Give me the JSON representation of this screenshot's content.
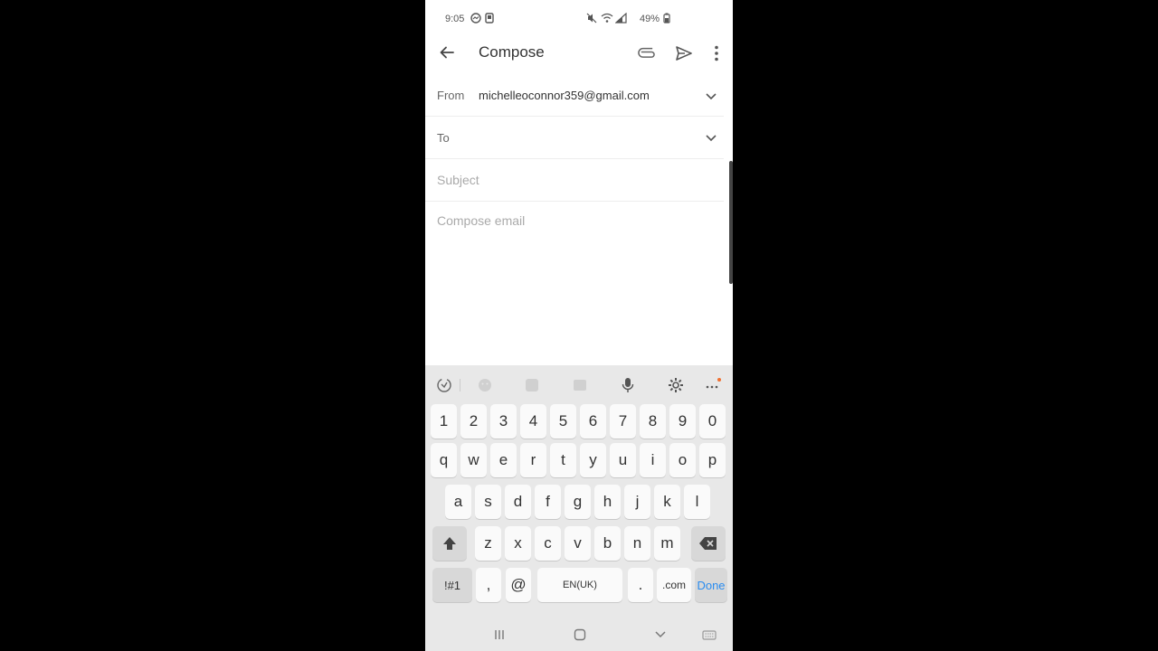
{
  "status_bar": {
    "time": "9:05",
    "battery": "49%"
  },
  "app_bar": {
    "title": "Compose"
  },
  "from": {
    "label": "From",
    "value": "michelleoconnor359@gmail.com"
  },
  "to": {
    "label": "To"
  },
  "subject": {
    "placeholder": "Subject"
  },
  "body": {
    "placeholder": "Compose email"
  },
  "keyboard": {
    "number_row": [
      "1",
      "2",
      "3",
      "4",
      "5",
      "6",
      "7",
      "8",
      "9",
      "0"
    ],
    "row1": [
      "q",
      "w",
      "e",
      "r",
      "t",
      "y",
      "u",
      "i",
      "o",
      "p"
    ],
    "row2": [
      "a",
      "s",
      "d",
      "f",
      "g",
      "h",
      "j",
      "k",
      "l"
    ],
    "row3": [
      "z",
      "x",
      "c",
      "v",
      "b",
      "n",
      "m"
    ],
    "symbols_label": "!#1",
    "comma_label": ",",
    "at_label": "@",
    "space_label": "EN(UK)",
    "period_label": ".",
    "dotcom_label": ".com",
    "done_label": "Done"
  },
  "colors": {
    "accent": "#2a8cf0"
  }
}
